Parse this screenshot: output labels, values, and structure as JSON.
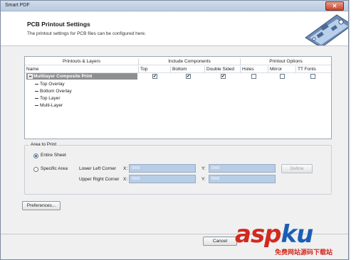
{
  "window": {
    "title": "Smart PDF",
    "close_glyph": "✕"
  },
  "header": {
    "title": "PCB Printout Settings",
    "subtitle": "The printout settings for PCB files can be configured here."
  },
  "table": {
    "groups": [
      "Printouts & Layers",
      "Include Components",
      "Printout Options"
    ],
    "columns": [
      "Name",
      "Top",
      "Bottom",
      "Double Sided",
      "Holes",
      "Mirror",
      "TT Fonts"
    ],
    "composite": {
      "name": "Multilayer Composite Print",
      "checks": {
        "top": true,
        "bottom": true,
        "double_sided": true,
        "holes": false,
        "mirror": false,
        "tt_fonts": false
      }
    },
    "layers": [
      "Top Overlay",
      "Bottom Overlay",
      "Top Layer",
      "Multi-Layer"
    ]
  },
  "area": {
    "title": "Area to Print",
    "entire_sheet": "Entire Sheet",
    "specific_area": "Specific Area",
    "selected": "entire_sheet",
    "lower_left": {
      "label": "Lower Left Corner",
      "x_label": "X:",
      "x": "0mil",
      "y_label": "Y:",
      "y": "0mil"
    },
    "upper_right": {
      "label": "Upper Right Corner",
      "x_label": "X:",
      "x": "0mil",
      "y_label": "Y:",
      "y": "0mil"
    },
    "define": "Define"
  },
  "buttons": {
    "preferences": "Preferences...",
    "cancel": "Cancel"
  },
  "watermark": {
    "main_a": "asp",
    "main_b": "ku",
    "sub": "免费网站源码下载站"
  }
}
